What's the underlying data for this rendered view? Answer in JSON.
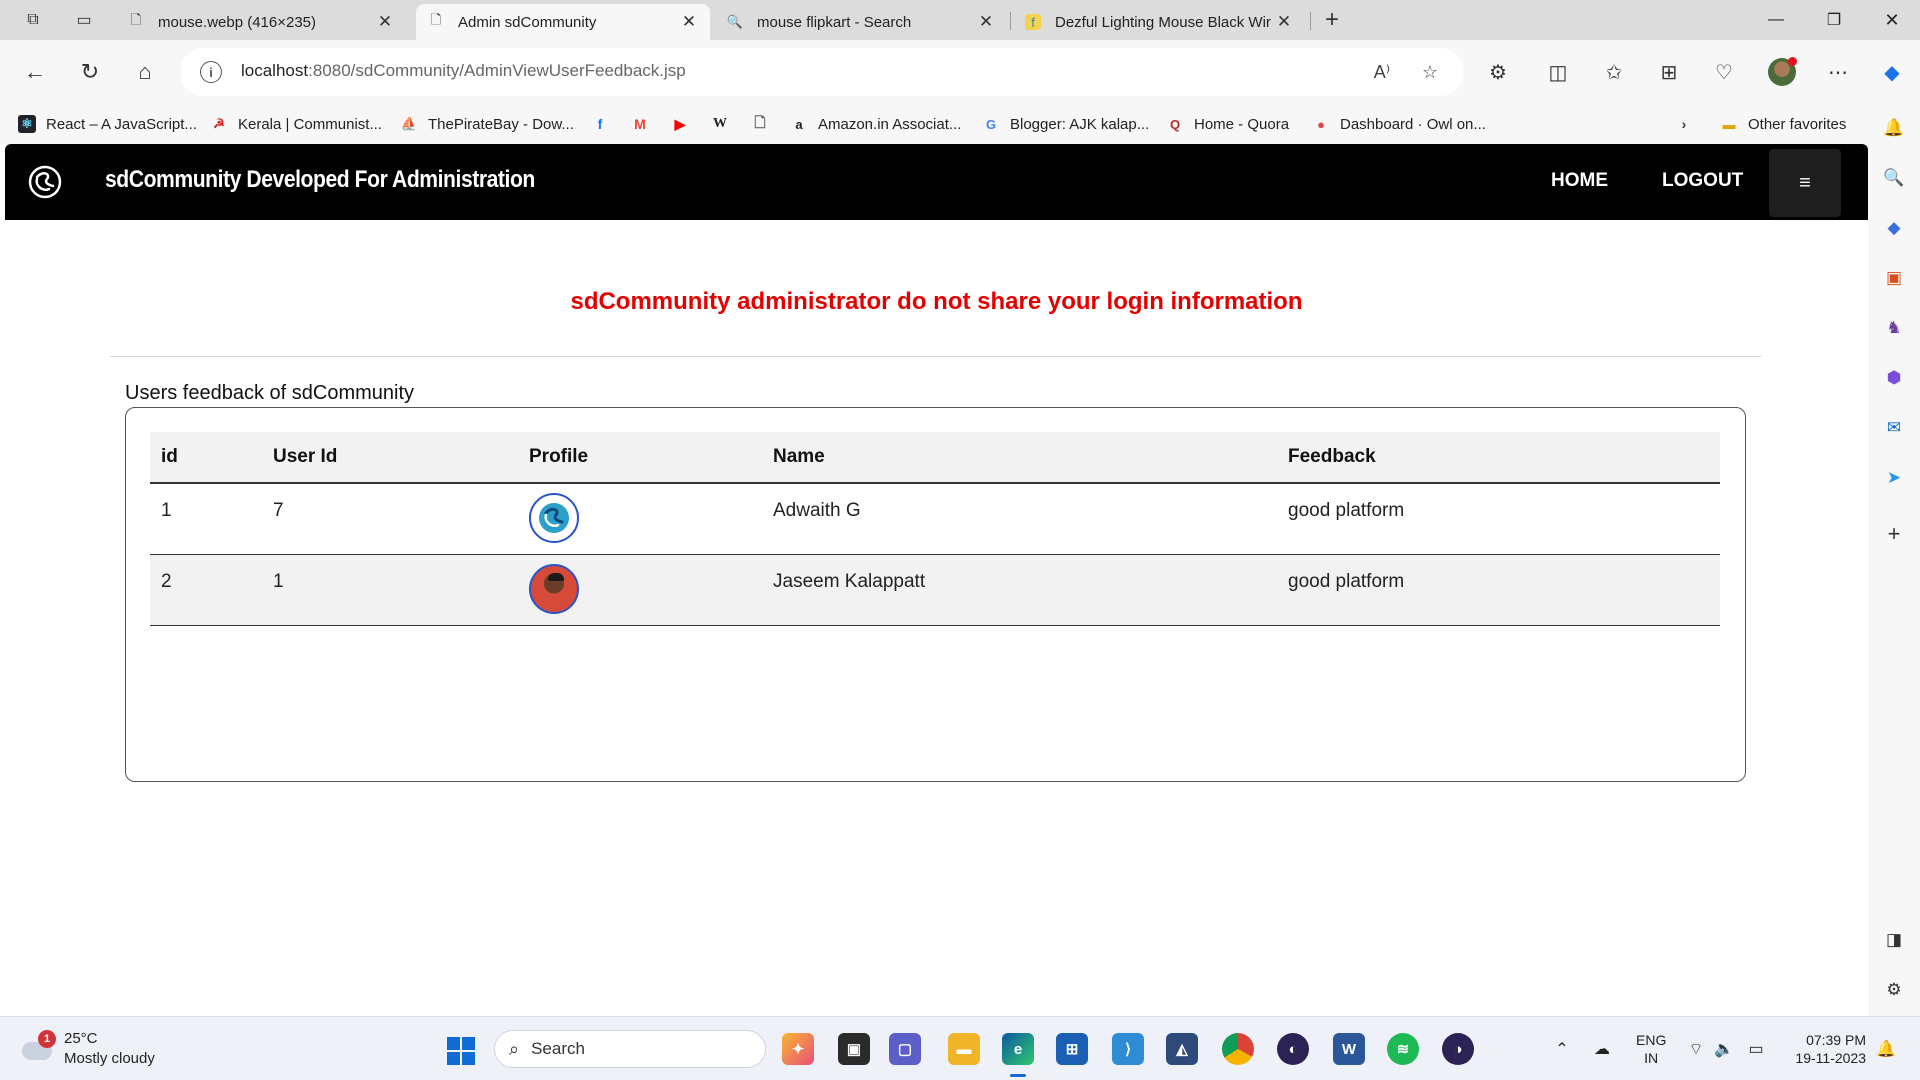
{
  "browser": {
    "tabs": [
      {
        "label": "mouse.webp (416×235)",
        "active": false
      },
      {
        "label": "Admin sdCommunity",
        "active": true
      },
      {
        "label": "mouse flipkart - Search",
        "active": false
      },
      {
        "label": "Dezful Lighting Mouse Black Wir",
        "active": false
      }
    ],
    "url_host": "localhost",
    "url_rest": ":8080/sdCommunity/AdminViewUserFeedback.jsp",
    "favorites": [
      {
        "label": "React – A JavaScript..."
      },
      {
        "label": "Kerala | Communist..."
      },
      {
        "label": "ThePirateBay - Dow..."
      },
      {
        "label": "Amazon.in Associat..."
      },
      {
        "label": "Blogger: AJK kalap..."
      },
      {
        "label": "Home - Quora"
      },
      {
        "label": "Dashboard · Owl on..."
      }
    ],
    "other_favorites": "Other favorites"
  },
  "site": {
    "brand": "sdCommunity Developed For Administration",
    "nav": {
      "home": "HOME",
      "logout": "LOGOUT",
      "menu_icon": "≡"
    },
    "warning": "sdCommunity administrator do not share your login information",
    "section_title": "Users feedback of sdCommunity",
    "table": {
      "headers": [
        "id",
        "User Id",
        "Profile",
        "Name",
        "Feedback"
      ],
      "rows": [
        {
          "id": "1",
          "user_id": "7",
          "profile": "logo-avatar",
          "name": "Adwaith G",
          "feedback": "good platform"
        },
        {
          "id": "2",
          "user_id": "1",
          "profile": "photo-avatar",
          "name": "Jaseem Kalappatt",
          "feedback": "good platform"
        }
      ]
    }
  },
  "taskbar": {
    "weather_temp": "25°C",
    "weather_desc": "Mostly cloudy",
    "weather_badge": "1",
    "search_placeholder": "Search",
    "lang_top": "ENG",
    "lang_bottom": "IN",
    "time": "07:39 PM",
    "date": "19-11-2023"
  },
  "colors": {
    "warning_red": "#e50000",
    "navbar_bg": "#000000",
    "accent_blue": "#0f6cd6"
  }
}
